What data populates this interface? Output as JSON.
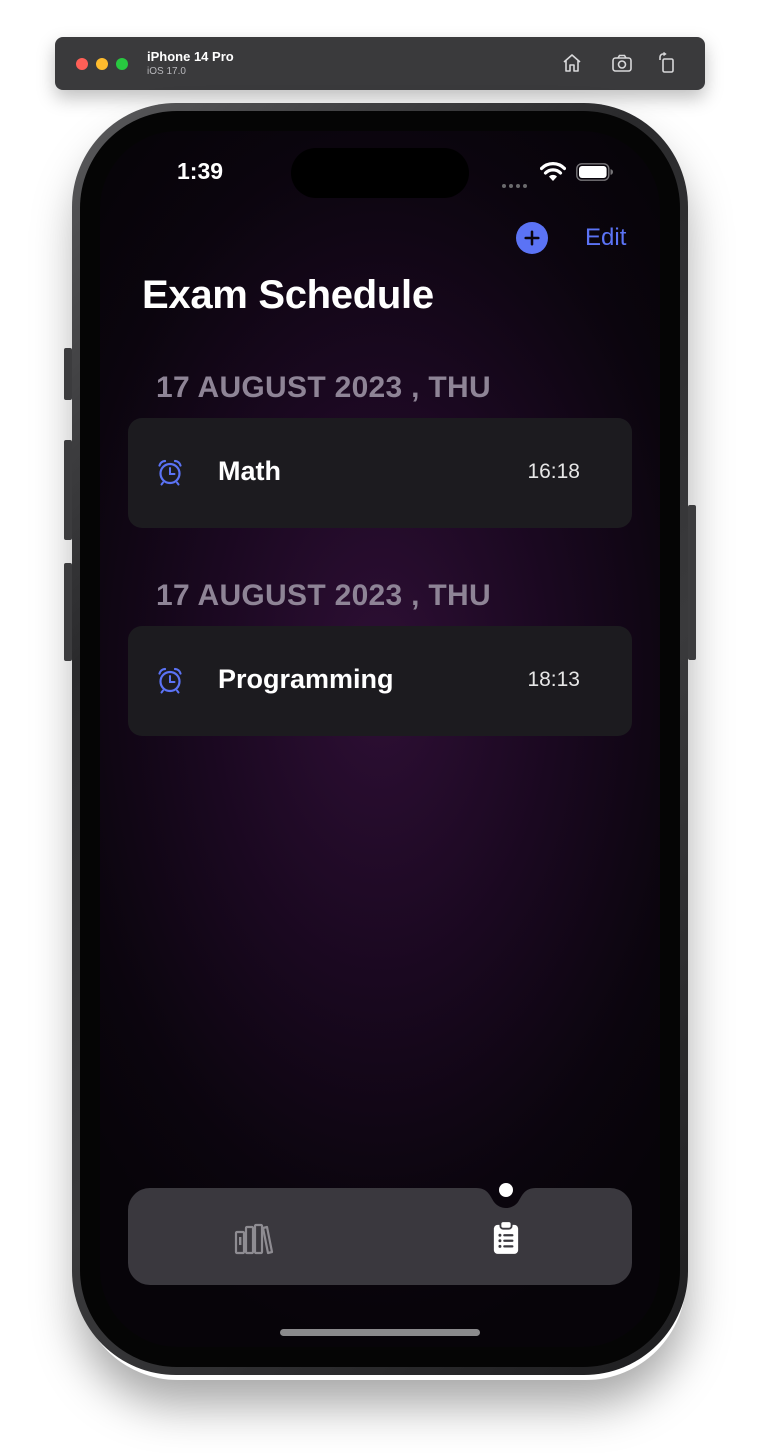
{
  "simulator": {
    "device_name": "iPhone 14 Pro",
    "os_version": "iOS 17.0",
    "toolbar_icons": [
      "home-icon",
      "screenshot-icon",
      "rotate-icon"
    ]
  },
  "status_bar": {
    "time": "1:39",
    "icons": [
      "signal-dots-icon",
      "wifi-icon",
      "battery-icon"
    ]
  },
  "nav": {
    "add_icon": "plus-circle-icon",
    "edit_label": "Edit",
    "title": "Exam Schedule"
  },
  "sections": [
    {
      "header": "17 AUGUST 2023 , THU",
      "item": {
        "icon": "alarm-clock-icon",
        "subject": "Math",
        "time": "16:18"
      }
    },
    {
      "header": "17 AUGUST 2023 , THU",
      "item": {
        "icon": "alarm-clock-icon",
        "subject": "Programming",
        "time": "18:13"
      }
    }
  ],
  "tab_bar": {
    "tabs": [
      {
        "icon": "books-icon",
        "selected": false
      },
      {
        "icon": "clipboard-list-icon",
        "selected": true
      }
    ]
  },
  "colors": {
    "accent": "#5b73f5",
    "card_bg": "#1c1b1f",
    "section_header": "#8e8496",
    "tab_bar_bg": "#3a383e",
    "background_glow": "#2e0f35"
  }
}
